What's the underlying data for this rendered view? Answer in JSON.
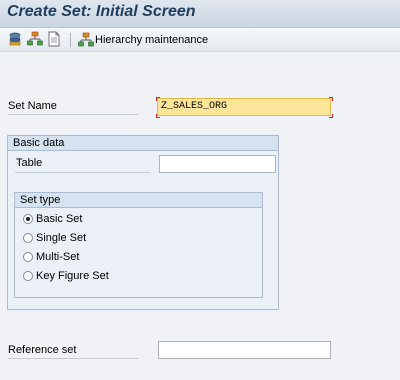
{
  "window": {
    "title": "Create Set: Initial Screen"
  },
  "toolbar": {
    "icons": [
      "other-set-icon",
      "hierarchy-icon",
      "document-icon"
    ],
    "hierarchy_maintenance_label": "Hierarchy maintenance"
  },
  "form": {
    "set_name": {
      "label": "Set Name",
      "value": "Z_SALES_ORG"
    },
    "basic_data": {
      "title": "Basic data",
      "table": {
        "label": "Table",
        "value": ""
      },
      "set_type": {
        "title": "Set type",
        "options": [
          {
            "label": "Basic Set",
            "checked": true
          },
          {
            "label": "Single Set",
            "checked": false
          },
          {
            "label": "Multi-Set",
            "checked": false
          },
          {
            "label": "Key Figure Set",
            "checked": false
          }
        ]
      }
    },
    "reference_set": {
      "label": "Reference set",
      "value": ""
    }
  },
  "colors": {
    "title_text": "#1f3d5c",
    "focused_field": "#fbe59a",
    "group_background": "#eaf0f6"
  }
}
